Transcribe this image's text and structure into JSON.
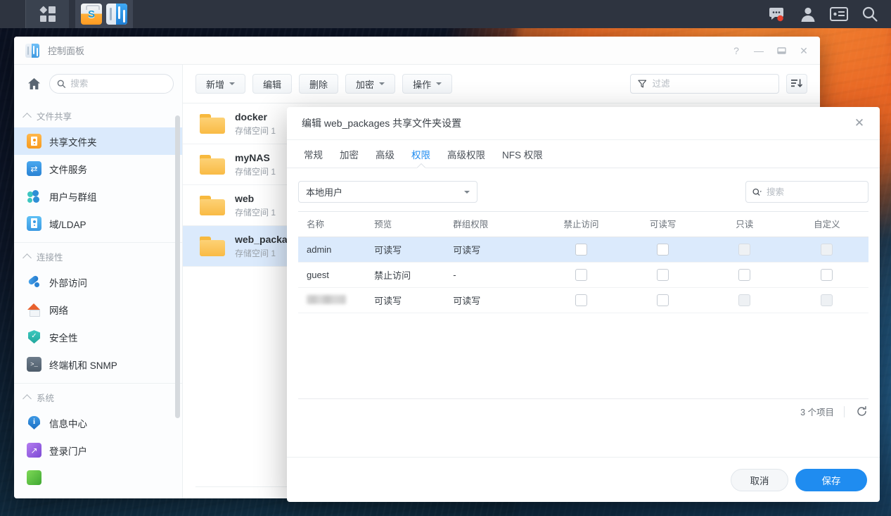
{
  "taskbar": {
    "apps_button": "apps-grid-icon",
    "tasks": [
      {
        "name": "package-center",
        "icon": "package-center-icon"
      },
      {
        "name": "control-panel",
        "icon": "control-panel-icon"
      }
    ],
    "tray": [
      {
        "name": "notifications",
        "icon": "chat-bubble-icon",
        "badge": true
      },
      {
        "name": "user-account",
        "icon": "person-icon",
        "badge": false
      },
      {
        "name": "widgets",
        "icon": "widget-panel-icon",
        "badge": false
      },
      {
        "name": "search",
        "icon": "search-icon",
        "badge": false
      }
    ]
  },
  "window": {
    "title": "控制面板",
    "icon": "control-panel-icon",
    "buttons": {
      "help": "?",
      "minimize": "—",
      "maximize": "▭",
      "close": "✕"
    }
  },
  "sidebar": {
    "home_icon": "home-icon",
    "search": {
      "placeholder": "搜索",
      "value": "",
      "icon": "search-icon"
    },
    "groups": [
      {
        "title": "文件共享",
        "items": [
          {
            "label": "共享文件夹",
            "icon": "shared-folder-icon",
            "active": true
          },
          {
            "label": "文件服务",
            "icon": "file-service-icon",
            "active": false
          },
          {
            "label": "用户与群组",
            "icon": "users-groups-icon",
            "active": false
          },
          {
            "label": "域/LDAP",
            "icon": "domain-ldap-icon",
            "active": false
          }
        ]
      },
      {
        "title": "连接性",
        "items": [
          {
            "label": "外部访问",
            "icon": "external-access-icon",
            "active": false
          },
          {
            "label": "网络",
            "icon": "network-icon",
            "active": false
          },
          {
            "label": "安全性",
            "icon": "security-icon",
            "active": false
          },
          {
            "label": "终端机和 SNMP",
            "icon": "terminal-snmp-icon",
            "active": false
          }
        ]
      },
      {
        "title": "系统",
        "items": [
          {
            "label": "信息中心",
            "icon": "info-center-icon",
            "active": false
          },
          {
            "label": "登录门户",
            "icon": "login-portal-icon",
            "active": false
          }
        ]
      }
    ]
  },
  "toolbar": {
    "buttons": [
      {
        "label": "新增",
        "caret": true
      },
      {
        "label": "编辑",
        "caret": false
      },
      {
        "label": "删除",
        "caret": false
      },
      {
        "label": "加密",
        "caret": true
      },
      {
        "label": "操作",
        "caret": true
      }
    ],
    "filter": {
      "placeholder": "过滤",
      "value": "",
      "icon": "funnel-icon"
    },
    "list_toggle": "list-sort-icon"
  },
  "folders": [
    {
      "name": "docker",
      "subtitle": "存储空间 1",
      "selected": false
    },
    {
      "name": "myNAS",
      "subtitle": "存储空间 1",
      "selected": false
    },
    {
      "name": "web",
      "subtitle": "存储空间 1",
      "selected": false
    },
    {
      "name": "web_packages",
      "subtitle": "存储空间 1",
      "selected": true
    }
  ],
  "dialog": {
    "title": "编辑 web_packages 共享文件夹设置",
    "close_icon": "close-icon",
    "tabs": [
      {
        "label": "常规",
        "active": false
      },
      {
        "label": "加密",
        "active": false
      },
      {
        "label": "高级",
        "active": false
      },
      {
        "label": "权限",
        "active": true
      },
      {
        "label": "高级权限",
        "active": false
      },
      {
        "label": "NFS 权限",
        "active": false
      }
    ],
    "user_select": {
      "value": "本地用户",
      "icon": "chevron-down-icon"
    },
    "search": {
      "placeholder": "搜索",
      "value": "",
      "icon": "search-dropdown-icon"
    },
    "table": {
      "columns": [
        "名称",
        "预览",
        "群组权限",
        "禁止访问",
        "可读写",
        "只读",
        "自定义"
      ],
      "rows": [
        {
          "name": "admin",
          "name_blurred": false,
          "preview": "可读写",
          "preview_state": "rw",
          "group_perm": "可读写",
          "group_perm_state": "rw",
          "no_access": false,
          "read_write": false,
          "read_only": false,
          "custom": false,
          "no_access_dim": false,
          "read_write_dim": false,
          "read_only_dim": true,
          "custom_dim": true,
          "selected": true
        },
        {
          "name": "guest",
          "name_blurred": false,
          "preview": "禁止访问",
          "preview_state": "no",
          "group_perm": "-",
          "group_perm_state": "none",
          "no_access": false,
          "read_write": false,
          "read_only": false,
          "custom": false,
          "no_access_dim": false,
          "read_write_dim": false,
          "read_only_dim": false,
          "custom_dim": false,
          "selected": false
        },
        {
          "name": "",
          "name_blurred": true,
          "preview": "可读写",
          "preview_state": "rw",
          "group_perm": "可读写",
          "group_perm_state": "rw",
          "no_access": false,
          "read_write": false,
          "read_only": false,
          "custom": false,
          "no_access_dim": false,
          "read_write_dim": false,
          "read_only_dim": true,
          "custom_dim": true,
          "selected": false
        }
      ]
    },
    "footer": {
      "count_text": "3 个项目",
      "refresh_icon": "refresh-icon",
      "cancel_label": "取消",
      "save_label": "保存"
    }
  },
  "colors": {
    "accent": "#1f8cf0",
    "selected_row": "#dbeafc",
    "warn_text": "#e08a2e",
    "danger_text": "#d9534f",
    "taskbar_bg": "#2e3440"
  }
}
